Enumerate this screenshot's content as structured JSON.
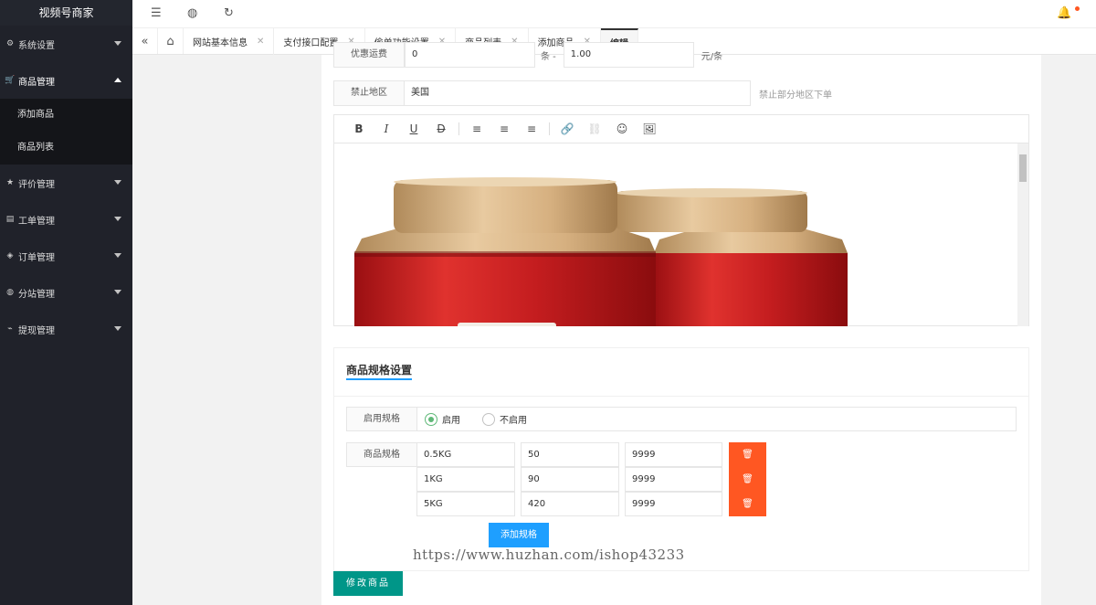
{
  "app": {
    "logo": "视频号商家"
  },
  "sidebar": {
    "items": [
      {
        "icon": "⚙",
        "label": "系统设置"
      },
      {
        "icon": "🛒",
        "label": "商品管理"
      },
      {
        "icon": "★",
        "label": "评价管理"
      },
      {
        "icon": "▤",
        "label": "工单管理"
      },
      {
        "icon": "◈",
        "label": "订单管理"
      },
      {
        "icon": "◍",
        "label": "分站管理"
      },
      {
        "icon": "⌁",
        "label": "提现管理"
      }
    ],
    "sub_items": [
      {
        "label": "添加商品"
      },
      {
        "label": "商品列表"
      }
    ]
  },
  "tabs": [
    {
      "label": "网站基本信息"
    },
    {
      "label": "支付接口配置"
    },
    {
      "label": "偷单功能设置"
    },
    {
      "label": "商品列表"
    },
    {
      "label": "添加商品"
    },
    {
      "label": "编辑"
    }
  ],
  "form": {
    "partial_label": "优惠运费",
    "partial_value1": "0",
    "partial_mid": "条 -",
    "partial_value2": "1.00",
    "partial_suffix": "元/条",
    "ban_label": "禁止地区",
    "ban_value": "美国",
    "ban_hint": "禁止部分地区下单"
  },
  "editor": {
    "tools": [
      "B",
      "I",
      "U",
      "D",
      "≡",
      "≡",
      "≡",
      "🔗",
      "⛓",
      "☺",
      "🖼"
    ]
  },
  "spec": {
    "title": "商品规格设置",
    "enable_label": "启用规格",
    "opt_on": "启用",
    "opt_off": "不启用",
    "spec_label": "商品规格",
    "rows": [
      {
        "name": "0.5KG",
        "price": "50",
        "stock": "9999"
      },
      {
        "name": "1KG",
        "price": "90",
        "stock": "9999"
      },
      {
        "name": "5KG",
        "price": "420",
        "stock": "9999"
      }
    ],
    "del_icon": "🗑",
    "add_button": "添加规格"
  },
  "submit_button": "修改商品",
  "watermark": "https://www.huzhan.com/ishop43233"
}
